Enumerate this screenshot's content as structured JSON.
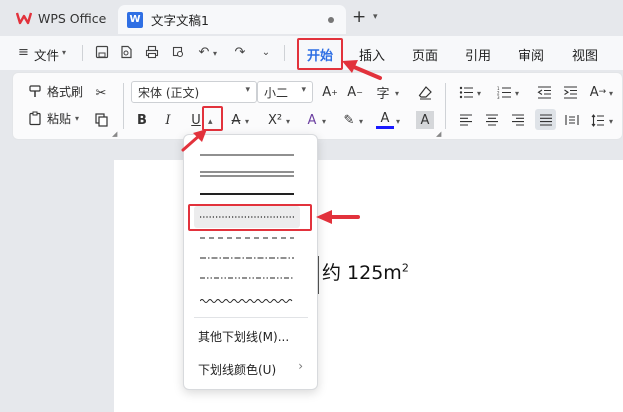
{
  "tabs": {
    "app_label": "WPS Office",
    "doc_icon_letter": "W",
    "doc_label": "文字文稿1",
    "new_tab_symbol": "+",
    "chevron": "⌄"
  },
  "menubar": {
    "file_label": "文件",
    "tabs": [
      "开始",
      "插入",
      "页面",
      "引用",
      "审阅",
      "视图"
    ],
    "active_tab": "开始"
  },
  "ribbon": {
    "format_painter_label": "格式刷",
    "paste_label": "粘贴",
    "font_name": "宋体 (正文)",
    "font_size": "小二",
    "bold": "B",
    "italic": "I",
    "underline": "U",
    "strikethrough": "A",
    "superscript": "X²",
    "text_effect": "A",
    "highlight": "✎",
    "font_color": "A",
    "char_shading": "A",
    "grow_font": "A⁺",
    "shrink_font": "A⁻",
    "phonetic": "字",
    "clear_format": "◇"
  },
  "document": {
    "text_prefix": "约 125m",
    "superscript": "2"
  },
  "dropdown": {
    "other_underline_label": "其他下划线(M)...",
    "underline_color_label": "下划线颜色(U)",
    "submenu_arrow": "›"
  },
  "colors": {
    "accent": "#2f6fe4",
    "annotation": "#e2323c",
    "font_color_bar": "#1a1aff"
  }
}
